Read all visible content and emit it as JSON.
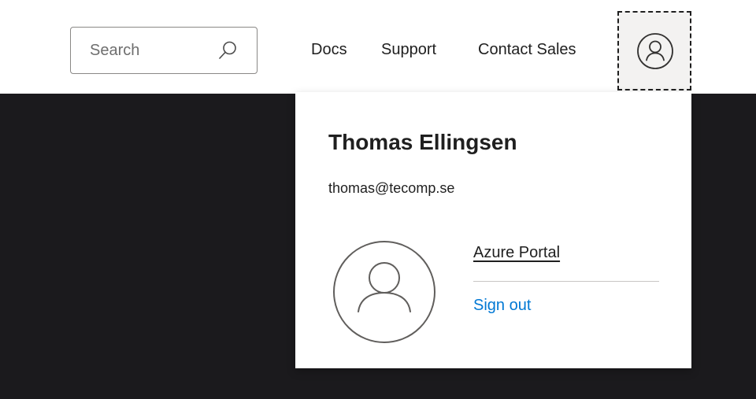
{
  "header": {
    "search": {
      "placeholder": "Search",
      "icon": "search-icon"
    },
    "nav": {
      "docs": "Docs",
      "support": "Support",
      "contact_sales": "Contact Sales"
    },
    "profile_button_icon": "person-icon"
  },
  "profile_menu": {
    "name": "Thomas Ellingsen",
    "email": "thomas@tecomp.se",
    "avatar_icon": "person-icon",
    "links": {
      "azure_portal": "Azure Portal",
      "sign_out": "Sign out"
    }
  },
  "colors": {
    "hero_background": "#1b1a1d",
    "link_accent": "#0078d4",
    "profile_button_background": "#f3f2f1"
  }
}
